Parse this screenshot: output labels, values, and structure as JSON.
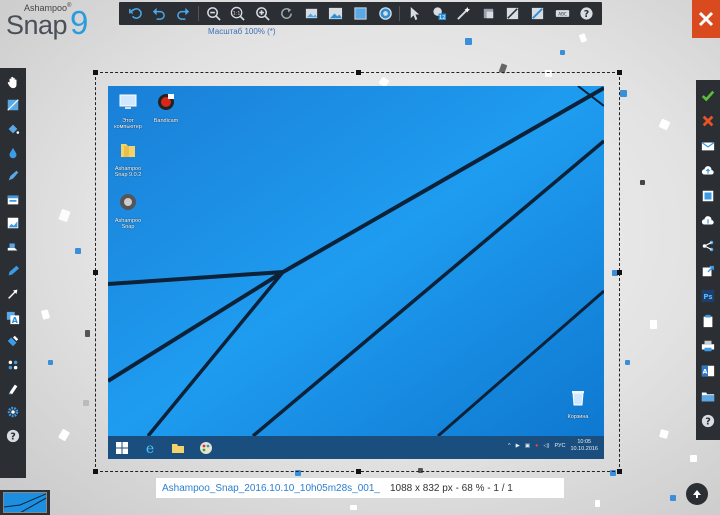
{
  "app": {
    "brand": "Ashampoo",
    "brand_mark": "®",
    "name": "Snap",
    "version": "9"
  },
  "toolbar": {
    "zoom_label": "Масштаб 100% (*)",
    "items": [
      {
        "name": "undo-all-icon"
      },
      {
        "name": "undo-icon"
      },
      {
        "name": "redo-icon"
      },
      {
        "name": "zoom-out-icon"
      },
      {
        "name": "zoom-1to1-icon",
        "label": "1:1"
      },
      {
        "name": "zoom-in-icon"
      },
      {
        "name": "rotate-icon"
      },
      {
        "name": "image-small-icon"
      },
      {
        "name": "image-large-icon"
      },
      {
        "name": "fill-icon"
      },
      {
        "name": "circle-target-icon"
      },
      {
        "name": "pointer-icon"
      },
      {
        "name": "step-numbers-icon",
        "label": "12"
      },
      {
        "name": "magic-wand-icon"
      },
      {
        "name": "crop-icon"
      },
      {
        "name": "slash-icon"
      },
      {
        "name": "diagonal-icon"
      },
      {
        "name": "text-abc-icon",
        "label": "ABC"
      },
      {
        "name": "help-icon",
        "label": "?"
      }
    ]
  },
  "left_toolbar": [
    "hand-icon",
    "crop-frame-icon",
    "bucket-icon",
    "drop-icon",
    "pen-icon",
    "window-icon",
    "image-icon",
    "stamp-icon",
    "pencil-icon",
    "arrow-icon",
    "text-a-icon",
    "highlight-icon",
    "dots-icon",
    "marker-icon",
    "gear-icon",
    "help-icon"
  ],
  "left_labels": {
    "text": "A",
    "help": "?"
  },
  "right_toolbar": [
    "check-icon",
    "cancel-icon",
    "email-icon",
    "cloud-upload-icon",
    "print-frame-icon",
    "cloud-icon",
    "share-icon",
    "export-icon",
    "photoshop-icon",
    "clipboard-icon",
    "printer-icon",
    "word-icon",
    "folder-icon",
    "help-icon"
  ],
  "right_labels": {
    "ps": "Ps",
    "word": "A",
    "help": "?"
  },
  "desktop": {
    "icons": [
      {
        "label": "Этот компьютер",
        "icon": "computer-icon"
      },
      {
        "label": "Bandicam",
        "icon": "bandicam-icon"
      },
      {
        "label": "Ashampoo Snap 9.0.2",
        "icon": "folder-icon"
      },
      {
        "label": "Ashampoo Snap",
        "icon": "snap-app-icon"
      },
      {
        "label": "Корзина",
        "icon": "recycle-bin-icon"
      }
    ],
    "tray_lang": "РУС",
    "clock_time": "10:05",
    "clock_date": "10.10.2016"
  },
  "status": {
    "file_name": "Ashampoo_Snap_2016.10.10_10h05m28s_001_",
    "file_info": "1088 x 832 px - 68 % - 1 / 1"
  },
  "colors": {
    "toolbar_bg": "#2b2e33",
    "accent": "#2b9be0",
    "close": "#d94a1e",
    "check": "#5cbf3a",
    "cancel": "#e8532a"
  }
}
